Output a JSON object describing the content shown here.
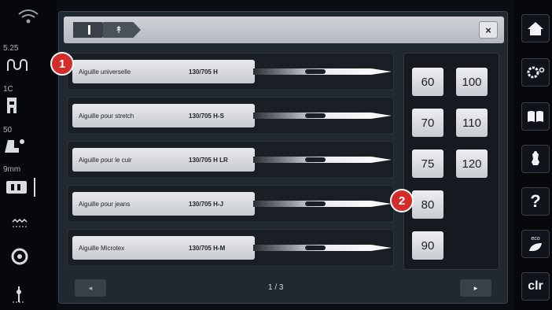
{
  "status_bar": {
    "stitch_width": "5.25",
    "tension": "1C",
    "presser_foot_pressure": "50",
    "needle_stop": "9mm"
  },
  "breadcrumb": {
    "crumb1_icon": "needle-bar-icon",
    "crumb2_icon": "needle-selection-icon"
  },
  "close_label": "×",
  "needles": [
    {
      "name": "Aiguille universelle",
      "code": "130/705 H"
    },
    {
      "name": "Aiguille pour stretch",
      "code": "130/705 H-S"
    },
    {
      "name": "Aiguille pour le cuir",
      "code": "130/705 H LR"
    },
    {
      "name": "Aiguille pour jeans",
      "code": "130/705 H-J"
    },
    {
      "name": "Aiguille Microtex",
      "code": "130/705 H-M"
    }
  ],
  "sizes": [
    "60",
    "100",
    "70",
    "110",
    "75",
    "120",
    "80",
    "90"
  ],
  "footer": {
    "prev_label": "◂",
    "page": "1 / 3",
    "next_label": "▸"
  },
  "callouts": [
    "1",
    "2"
  ],
  "right_bar": {
    "clear_label": "clr",
    "help_label": "?",
    "eco_label": "eco",
    "home_icon": "home-icon",
    "settings_icon": "settings-icon",
    "tutorial_icon": "book-icon",
    "creative_consultant_icon": "sewing-form-icon",
    "eco_icon": "leaf-icon"
  },
  "colors": {
    "callout": "#d42b2b",
    "button_light": "#e6e8eb",
    "panel_dark": "#222830"
  }
}
